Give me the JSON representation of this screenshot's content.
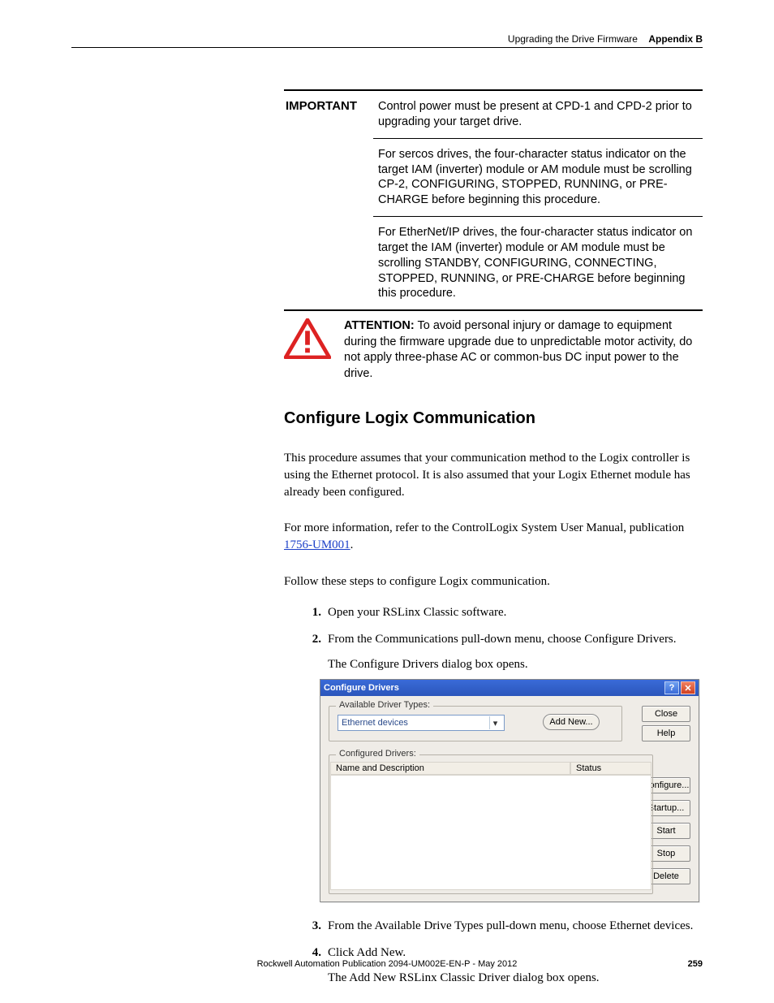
{
  "header": {
    "section_title": "Upgrading the Drive Firmware",
    "appendix": "Appendix B"
  },
  "important": {
    "label": "IMPORTANT",
    "cells": [
      "Control power must be present at CPD-1 and CPD-2 prior to upgrading your target drive.",
      "For sercos drives, the four-character status indicator on the target IAM (inverter) module or AM module must be scrolling CP-2, CONFIGURING, STOPPED, RUNNING, or PRE-CHARGE before beginning this procedure.",
      "For EtherNet/IP drives, the four-character status indicator on target the IAM (inverter) module or AM module must be scrolling STANDBY, CONFIGURING, CONNECTING, STOPPED, RUNNING, or PRE-CHARGE before beginning this procedure."
    ]
  },
  "attention": {
    "label": "ATTENTION:",
    "text": " To avoid personal injury or damage to equipment during the firmware upgrade due to unpredictable motor activity, do not apply three-phase AC or common-bus DC input power to the drive."
  },
  "heading": "Configure Logix Communication",
  "paragraphs": {
    "p1": "This procedure assumes that your communication method to the Logix controller is using the Ethernet protocol. It is also assumed that your Logix Ethernet module has already been configured.",
    "p2a": "For more information, refer to the ControlLogix System User Manual, publication ",
    "p2_link": "1756-UM001",
    "p2b": ".",
    "p3": "Follow these steps to configure Logix communication."
  },
  "steps1": {
    "n1": "1.",
    "t1": "Open your RSLinx Classic software.",
    "n2": "2.",
    "t2": "From the Communications pull-down menu, choose Configure Drivers.",
    "t2_sub": "The Configure Drivers dialog box opens."
  },
  "dialog": {
    "title": "Configure Drivers",
    "help_glyph": "?",
    "close_glyph": "✕",
    "group1_legend": "Available Driver Types:",
    "combo_value": "Ethernet devices",
    "caret": "▾",
    "add_new": "Add New...",
    "group2_legend": "Configured Drivers:",
    "col_name": "Name and Description",
    "col_status": "Status",
    "buttons": {
      "close": "Close",
      "help": "Help",
      "configure": "Configure...",
      "startup": "Startup...",
      "start": "Start",
      "stop": "Stop",
      "delete": "Delete"
    }
  },
  "steps2": {
    "n3": "3.",
    "t3": "From the Available Drive Types pull-down menu, choose Ethernet devices.",
    "n4": "4.",
    "t4": "Click Add New.",
    "t4_sub": "The Add New RSLinx Classic Driver dialog box opens."
  },
  "footer": {
    "pub": "Rockwell Automation Publication 2094-UM002E-EN-P - May 2012",
    "page": "259"
  }
}
